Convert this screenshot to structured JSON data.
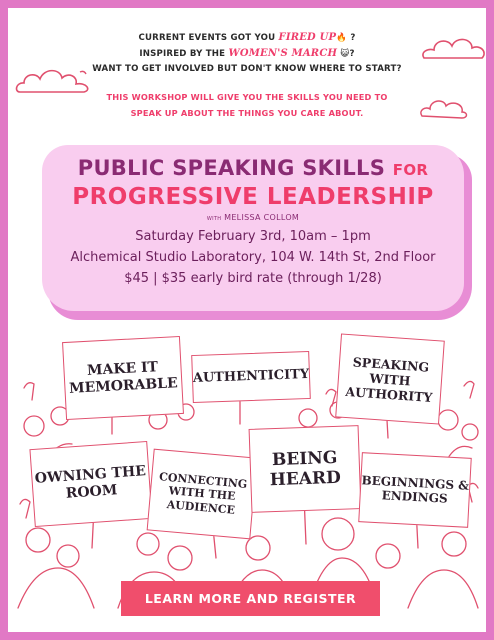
{
  "intro": {
    "line1_pre": "CURRENT EVENTS GOT YOU ",
    "line1_hl": "FIRED UP",
    "line1_post": "🔥 ?",
    "line2_pre": "INSPIRED BY THE ",
    "line2_hl": "WOMEN'S MARCH",
    "line2_post": " 😺?",
    "line3": "WANT TO GET INVOLVED BUT DON'T KNOW WHERE TO START?"
  },
  "pitch": {
    "line1": "THIS WORKSHOP WILL GIVE YOU THE SKILLS YOU NEED TO",
    "line2": "SPEAK UP ABOUT THE THINGS YOU CARE ABOUT."
  },
  "title": {
    "line1": "PUBLIC SPEAKING SKILLS",
    "for_word": "FOR",
    "line2": "PROGRESSIVE LEADERSHIP",
    "presenter_prefix": "WITH",
    "presenter_name": "MELISSA COLLOM"
  },
  "details": {
    "date": "Saturday February 3rd, 10am – 1pm",
    "location": "Alchemical Studio Laboratory, 104 W. 14th St, 2nd Floor",
    "price": "$45 | $35 early bird rate (through 1/28)"
  },
  "signs": {
    "make_it_memorable": "MAKE IT MEMORABLE",
    "authenticity": "AUTHENTICITY",
    "speaking_with_authority": "SPEAKING WITH AUTHORITY",
    "owning_the_room": "OWNING THE ROOM",
    "connecting_with_audience": "CONNECTING WITH THE AUDIENCE",
    "being_heard": "BEING HEARD",
    "beginnings_endings": "BEGINNINGS & ENDINGS"
  },
  "cta": {
    "label": "LEARN MORE AND REGISTER"
  },
  "colors": {
    "border": "#e179c5",
    "accent": "#ef3d6b",
    "title_box": "#f9cdef",
    "title_purple": "#8a2b73",
    "button": "#f04e6c"
  }
}
